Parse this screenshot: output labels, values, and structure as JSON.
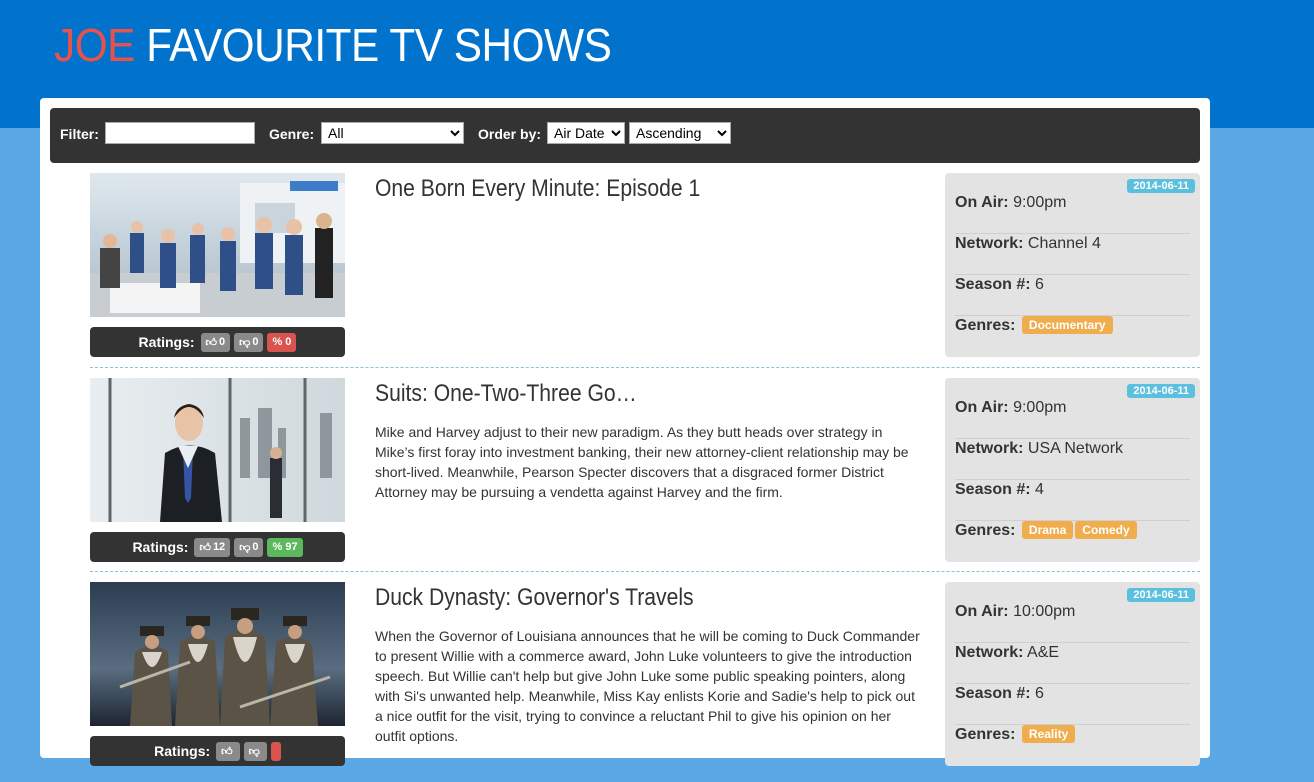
{
  "header": {
    "owner": "JOE",
    "title": "FAVOURITE TV SHOWS"
  },
  "filters": {
    "filter_label": "Filter:",
    "filter_value": "",
    "genre_label": "Genre:",
    "genre_selected": "All",
    "order_label": "Order by:",
    "order_field": "Air Date",
    "order_direction": "Ascending"
  },
  "labels": {
    "ratings": "Ratings:",
    "on_air": "On Air:",
    "network": "Network:",
    "season": "Season #:",
    "genres": "Genres:"
  },
  "shows": [
    {
      "title": "One Born Every Minute: Episode 1",
      "description": "",
      "likes": "0",
      "dislikes": "0",
      "percent": "% 0",
      "percent_color": "#d9534f",
      "date": "2014-06-11",
      "on_air": "9:00pm",
      "network": "Channel 4",
      "season": "6",
      "genres": [
        "Documentary"
      ]
    },
    {
      "title": "Suits: One-Two-Three Go…",
      "description": "Mike and Harvey adjust to their new paradigm. As they butt heads over strategy in Mike’s first foray into investment banking, their new attorney-client relationship may be short-lived. Meanwhile, Pearson Specter discovers that a disgraced former District Attorney may be pursuing a vendetta against Harvey and the firm.",
      "likes": "12",
      "dislikes": "0",
      "percent": "% 97",
      "percent_color": "#5cb85c",
      "date": "2014-06-11",
      "on_air": "9:00pm",
      "network": "USA Network",
      "season": "4",
      "genres": [
        "Drama",
        "Comedy"
      ]
    },
    {
      "title": "Duck Dynasty: Governor's Travels",
      "description": "When the Governor of Louisiana announces that he will be coming to Duck Commander to present Willie with a commerce award, John Luke volunteers to give the introduction speech. But Willie can't help but give John Luke some public speaking pointers, along with Si's unwanted help. Meanwhile, Miss Kay enlists Korie and Sadie's help to pick out a nice outfit for the visit, trying to convince a reluctant Phil to give his opinion on her outfit options.",
      "likes": "",
      "dislikes": "",
      "percent": "",
      "percent_color": "#d9534f",
      "date": "2014-06-11",
      "on_air": "10:00pm",
      "network": "A&E",
      "season": "6",
      "genres": [
        "Reality"
      ]
    }
  ],
  "colors": {
    "header_bg": "#0273cc",
    "owner_text": "#e8524a",
    "date_badge": "#5bc0de",
    "genre_tag": "#f0ad4e"
  },
  "icons": [
    "thumbs-up-icon",
    "thumbs-down-icon"
  ]
}
